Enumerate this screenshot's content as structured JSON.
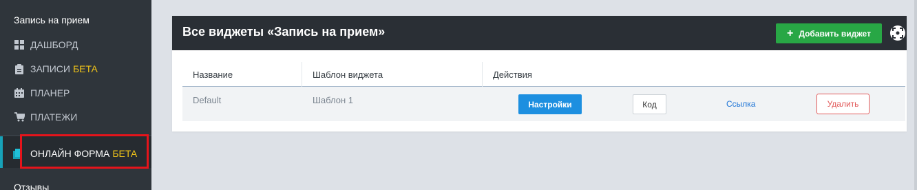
{
  "sidebar": {
    "title": "Запись на прием",
    "items": [
      {
        "icon": "dashboard-icon",
        "label": "ДАШБОРД",
        "beta": ""
      },
      {
        "icon": "clipboard-icon",
        "label": "ЗАПИСИ",
        "beta": "БЕТА"
      },
      {
        "icon": "calendar-icon",
        "label": "ПЛАНЕР",
        "beta": ""
      },
      {
        "icon": "cart-icon",
        "label": "ПЛАТЕЖИ",
        "beta": ""
      }
    ],
    "active_item": {
      "icon": "form-icon",
      "label": "ОНЛАЙН ФОРМА",
      "beta": "БЕТА"
    },
    "reviews_label": "Отзывы"
  },
  "panel": {
    "title": "Все виджеты «Запись на прием»",
    "add_button": "Добавить виджет",
    "expand_icon": "expand-icon"
  },
  "table": {
    "headers": [
      "Название",
      "Шаблон виджета",
      "Действия"
    ],
    "rows": [
      {
        "name": "Default",
        "template": "Шаблон 1",
        "actions": {
          "settings": "Настройки",
          "code": "Код",
          "link": "Ссылка",
          "delete": "Удалить"
        }
      }
    ]
  },
  "colors": {
    "sidebar_bg": "#2f353b",
    "header_bg": "#2a2f35",
    "accent_green": "#28a745",
    "accent_blue": "#1d8fe0",
    "beta": "#f0c419",
    "danger": "#e25858",
    "highlight": "#e5141b"
  }
}
